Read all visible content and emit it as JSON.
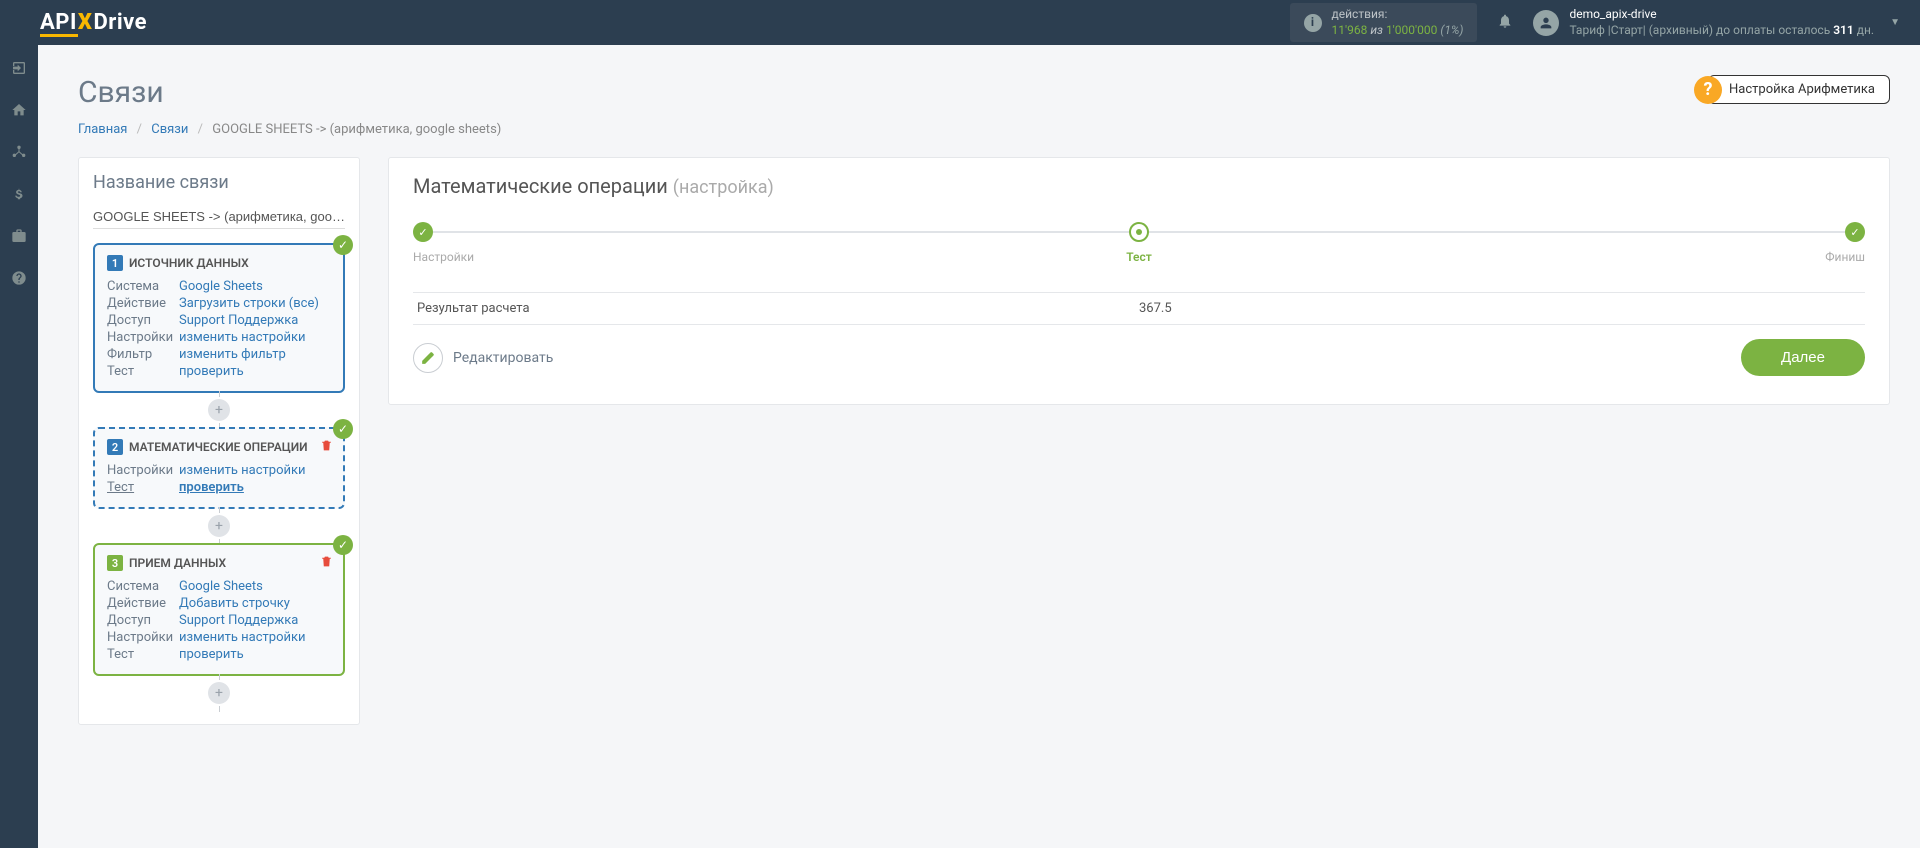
{
  "brand": {
    "api": "API",
    "x": "X",
    "drive": "Drive"
  },
  "topbar": {
    "actions_label": "действия:",
    "actions_value": "11'968",
    "actions_sep": "из",
    "actions_max": "1'000'000",
    "actions_pct": "(1%)"
  },
  "user": {
    "name": "demo_apix-drive",
    "tariff_prefix": "Тариф |Старт| (архивный) до оплаты осталось ",
    "tariff_days": "311",
    "tariff_suffix": " дн."
  },
  "page": {
    "title": "Связи",
    "help_label": "Настройка Арифметика"
  },
  "breadcrumb": {
    "home": "Главная",
    "links": "Связи",
    "current": "GOOGLE SHEETS -> (арифметика, google sheets)"
  },
  "left": {
    "heading": "Название связи",
    "conn_name": "GOOGLE SHEETS -> (арифметика, google sheets)",
    "step1": {
      "title": "ИСТОЧНИК ДАННЫХ",
      "rows": [
        {
          "k": "Система",
          "v": "Google Sheets"
        },
        {
          "k": "Действие",
          "v": "Загрузить строки (все)"
        },
        {
          "k": "Доступ",
          "v": "Support Поддержка"
        },
        {
          "k": "Настройки",
          "v": "изменить настройки"
        },
        {
          "k": "Фильтр",
          "v": "изменить фильтр"
        },
        {
          "k": "Тест",
          "v": "проверить"
        }
      ]
    },
    "step2": {
      "title": "МАТЕМАТИЧЕСКИЕ ОПЕРАЦИИ",
      "rows": [
        {
          "k": "Настройки",
          "v": "изменить настройки"
        },
        {
          "k": "Тест",
          "v": "проверить"
        }
      ]
    },
    "step3": {
      "title": "ПРИЕМ ДАННЫХ",
      "rows": [
        {
          "k": "Система",
          "v": "Google Sheets"
        },
        {
          "k": "Действие",
          "v": "Добавить строчку"
        },
        {
          "k": "Доступ",
          "v": "Support Поддержка"
        },
        {
          "k": "Настройки",
          "v": "изменить настройки"
        },
        {
          "k": "Тест",
          "v": "проверить"
        }
      ]
    }
  },
  "right": {
    "title_main": "Математические операции",
    "title_sub": "(настройка)",
    "stepper": {
      "s1": "Настройки",
      "s2": "Тест",
      "s3": "Финиш"
    },
    "result_label": "Результат расчета",
    "result_value": "367.5",
    "edit_label": "Редактировать",
    "next_label": "Далее"
  }
}
